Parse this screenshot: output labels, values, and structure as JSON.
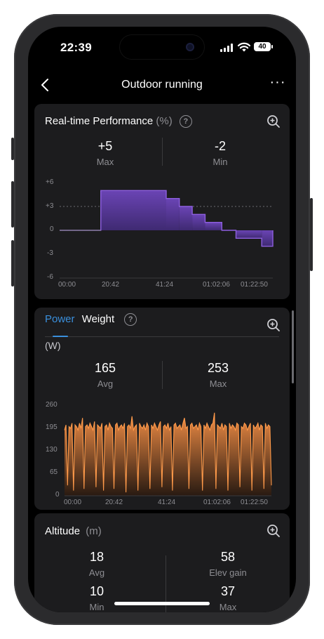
{
  "status": {
    "time": "22:39",
    "battery": "40"
  },
  "nav": {
    "title": "Outdoor running",
    "more": "···"
  },
  "perf": {
    "title": "Real-time Performance",
    "unit": "(%)",
    "help": "?",
    "stats": [
      {
        "value": "+5",
        "label": "Max"
      },
      {
        "value": "-2",
        "label": "Min"
      }
    ],
    "y_ticks": [
      "+6",
      "+3",
      "0",
      "-3",
      "-6"
    ],
    "x_ticks": [
      "00:00",
      "20:42",
      "41:24",
      "01:02:06",
      "01:22:50"
    ]
  },
  "power": {
    "tabs": [
      "Power",
      "Weight"
    ],
    "help": "?",
    "unit": "(W)",
    "stats": [
      {
        "value": "165",
        "label": "Avg"
      },
      {
        "value": "253",
        "label": "Max"
      }
    ],
    "y_ticks": [
      "260",
      "195",
      "130",
      "65",
      "0"
    ],
    "x_ticks": [
      "00:00",
      "20:42",
      "41:24",
      "01:02:06",
      "01:22:50"
    ]
  },
  "altitude": {
    "title": "Altitude",
    "unit": "(m)",
    "stats": [
      {
        "value": "18",
        "label": "Avg"
      },
      {
        "value": "58",
        "label": "Elev gain"
      },
      {
        "value": "10",
        "label": "Min"
      },
      {
        "value": "37",
        "label": "Max"
      }
    ]
  },
  "colors": {
    "perf_fill": "#5b3a9a",
    "perf_line": "#8e5fe0",
    "power_line": "#ff9a4a",
    "tab_active": "#3a8fdc"
  },
  "chart_data": [
    {
      "type": "area",
      "title": "Real-time Performance",
      "ylabel": "(%)",
      "x": [
        "00:00",
        "20:42",
        "41:24",
        "01:02:06",
        "01:22:50"
      ],
      "xlim_minutes": [
        0,
        82.8
      ],
      "ylim": [
        -6,
        6
      ],
      "steps": [
        {
          "x0": 0,
          "x1": 16,
          "y": 0
        },
        {
          "x0": 16,
          "x1": 41.4,
          "y": 5
        },
        {
          "x0": 41.4,
          "x1": 46.5,
          "y": 4
        },
        {
          "x0": 46.5,
          "x1": 51.5,
          "y": 3
        },
        {
          "x0": 51.5,
          "x1": 56.5,
          "y": 2
        },
        {
          "x0": 56.5,
          "x1": 63,
          "y": 1
        },
        {
          "x0": 63,
          "x1": 68.5,
          "y": 0
        },
        {
          "x0": 68.5,
          "x1": 78.5,
          "y": -1
        },
        {
          "x0": 78.5,
          "x1": 82.8,
          "y": -2
        }
      ],
      "reference_line": 3
    },
    {
      "type": "area",
      "title": "Power",
      "ylabel": "(W)",
      "x": [
        "00:00",
        "20:42",
        "41:24",
        "01:02:06",
        "01:22:50"
      ],
      "ylim": [
        0,
        260
      ],
      "values": [
        190,
        205,
        30,
        200,
        195,
        210,
        15,
        205,
        200,
        190,
        210,
        195,
        225,
        20,
        200,
        205,
        195,
        210,
        200,
        190,
        215,
        25,
        205,
        200,
        195,
        210,
        15,
        200,
        205,
        190,
        210,
        200,
        195,
        20,
        205,
        210,
        190,
        200,
        205,
        195,
        210,
        10,
        200,
        205,
        195,
        230,
        190,
        200,
        205,
        15,
        210,
        200,
        195,
        205,
        190,
        210,
        200,
        20,
        205,
        195,
        210,
        200,
        190,
        205,
        215,
        25,
        200,
        205,
        195,
        210,
        190,
        200,
        15,
        205,
        210,
        195,
        200,
        205,
        190,
        210,
        225,
        195,
        200,
        20,
        205,
        210,
        195,
        200,
        205,
        190,
        210,
        200,
        15,
        205,
        195,
        210,
        200,
        190,
        205,
        210,
        240,
        20,
        205,
        200,
        195,
        210,
        190,
        205,
        200,
        15,
        210,
        195,
        205,
        200,
        190,
        210,
        205,
        25,
        200,
        195,
        210,
        205,
        190,
        200,
        210,
        15,
        205,
        195,
        200,
        210,
        190,
        205,
        200,
        20,
        210,
        195,
        205,
        200,
        30
      ]
    }
  ]
}
